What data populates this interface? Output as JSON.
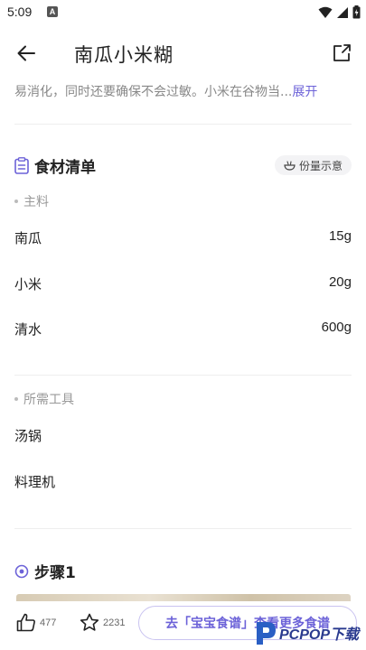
{
  "status_bar": {
    "time": "5:09",
    "notif_letter": "A"
  },
  "header": {
    "title": "南瓜小米糊"
  },
  "intro": {
    "text": "易消化，同时还要确保不会过敏。小米在谷物当...",
    "more": "展开"
  },
  "ingredients": {
    "title": "食材清单",
    "portion_button": "份量示意",
    "main_label": "主料",
    "main_items": [
      {
        "name": "南瓜",
        "amount": "15g"
      },
      {
        "name": "小米",
        "amount": "20g"
      },
      {
        "name": "清水",
        "amount": "600g"
      }
    ],
    "tools_label": "所需工具",
    "tools": [
      {
        "name": "汤锅"
      },
      {
        "name": "料理机"
      }
    ]
  },
  "steps": {
    "title": "步骤1"
  },
  "bottom_bar": {
    "like_count": "477",
    "fav_count": "2231",
    "cta_label": "去「宝宝食谱」查看更多食谱"
  },
  "watermark": {
    "text": "PCPOP下载"
  },
  "colors": {
    "accent": "#6c62d8",
    "text": "#222222",
    "muted": "#999999"
  }
}
